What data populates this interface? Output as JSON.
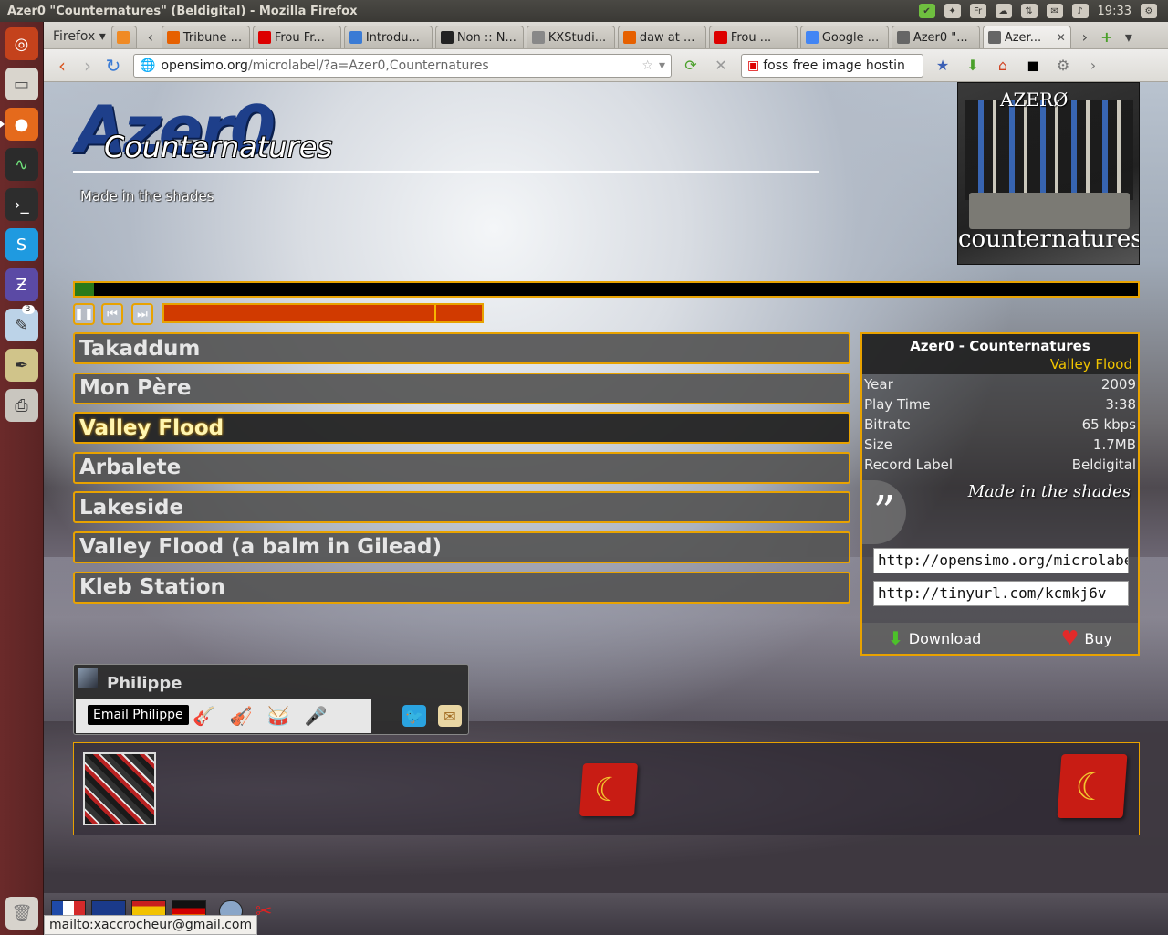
{
  "window_title": "Azer0 \"Counternatures\" (Beldigital) - Mozilla Firefox",
  "tray": {
    "time": "19:33",
    "fr": "Fr"
  },
  "launcher": [
    "ubuntu",
    "files",
    "firefox",
    "system-monitor",
    "terminal",
    "skype",
    "zim",
    "notes",
    "inkscape",
    "printer"
  ],
  "launcher_badge": "3",
  "browser": {
    "menu_label": "Firefox",
    "tabs": [
      {
        "label": "Tribune ...",
        "color": "#e66000"
      },
      {
        "label": "Frou Fr...",
        "color": "#d00"
      },
      {
        "label": "Introdu...",
        "color": "#3a7bd5"
      },
      {
        "label": "Non :: N...",
        "color": "#222"
      },
      {
        "label": "KXStudi...",
        "color": "#888"
      },
      {
        "label": "daw at ...",
        "color": "#e66000"
      },
      {
        "label": "Frou ...",
        "color": "#d00"
      },
      {
        "label": "Google ...",
        "color": "#4285f4"
      },
      {
        "label": "Azer0 \"...",
        "color": "#666"
      },
      {
        "label": "Azer...",
        "color": "#666"
      }
    ],
    "url_host": "opensimo.org",
    "url_path": "/microlabel/?a=Azer0,Counternatures",
    "search_text": "foss free image hostin"
  },
  "page": {
    "logo_main": "Azer0",
    "logo_sub": "Counternatures",
    "tagline": "Made in the shades",
    "cover_band": "AZERØ",
    "cover_title": "counternatures",
    "progress_fraction": 0.018,
    "volume_fraction": 0.85,
    "tracks": [
      "Takaddum",
      "Mon Père",
      "Valley Flood",
      "Arbalete",
      "Lakeside",
      "Valley Flood (a balm in Gilead)",
      "Kleb Station"
    ],
    "current_track_index": 2,
    "info": {
      "header": "Azer0 - Counternatures",
      "track": "Valley Flood",
      "rows": [
        {
          "key": "Year",
          "value": "2009"
        },
        {
          "key": "Play Time",
          "value": "3:38"
        },
        {
          "key": "Bitrate",
          "value": "65 kbps"
        },
        {
          "key": "Size",
          "value": "1.7MB"
        },
        {
          "key": "Record Label",
          "value": "Beldigital"
        }
      ],
      "description": "Made in the shades",
      "link1": "http://opensimo.org/microlabel",
      "link2": "http://tinyurl.com/kcmkj6v",
      "download_label": "Download",
      "buy_label": "Buy"
    },
    "artist": {
      "name": "Philippe",
      "email_tooltip": "Email Philippe"
    }
  },
  "status_url": "mailto:xaccrocheur@gmail.com"
}
